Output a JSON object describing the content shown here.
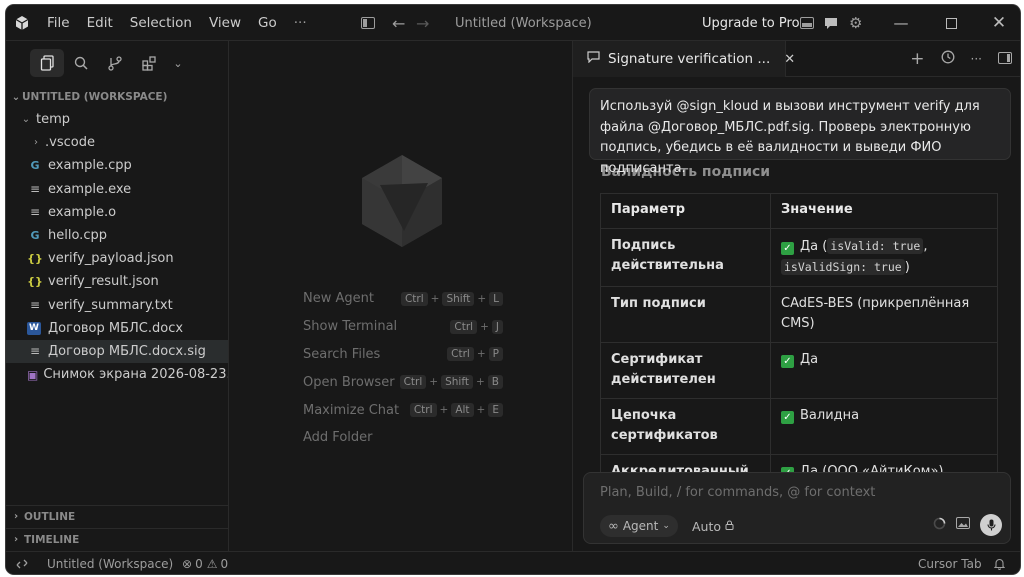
{
  "titlebar": {
    "menu": [
      "File",
      "Edit",
      "Selection",
      "View",
      "Go"
    ],
    "more": "···",
    "title": "Untitled (Workspace)",
    "upgrade": "Upgrade to Pro"
  },
  "sidebar": {
    "workspace_header": "UNTITLED (WORKSPACE)",
    "tree": [
      {
        "label": "temp",
        "kind": "folder-open",
        "indent": 1
      },
      {
        "label": ".vscode",
        "kind": "folder-closed",
        "indent": 2
      },
      {
        "label": "example.cpp",
        "kind": "cpp",
        "indent": 2
      },
      {
        "label": "example.exe",
        "kind": "lines",
        "indent": 2
      },
      {
        "label": "example.o",
        "kind": "lines",
        "indent": 2
      },
      {
        "label": "hello.cpp",
        "kind": "cpp",
        "indent": 2
      },
      {
        "label": "verify_payload.json",
        "kind": "json",
        "indent": 2
      },
      {
        "label": "verify_result.json",
        "kind": "json",
        "indent": 2
      },
      {
        "label": "verify_summary.txt",
        "kind": "lines",
        "indent": 2
      },
      {
        "label": "Договор МБЛС.docx",
        "kind": "word",
        "indent": 2
      },
      {
        "label": "Договор МБЛС.docx.sig",
        "kind": "lines",
        "indent": 2,
        "selected": true
      },
      {
        "label": "Снимок экрана 2026-08-23...",
        "kind": "image",
        "indent": 2
      }
    ],
    "outline": "OUTLINE",
    "timeline": "TIMELINE"
  },
  "center": {
    "shortcuts": [
      {
        "label": "New Agent",
        "keys": [
          "Ctrl",
          "Shift",
          "L"
        ]
      },
      {
        "label": "Show Terminal",
        "keys": [
          "Ctrl",
          "J"
        ]
      },
      {
        "label": "Search Files",
        "keys": [
          "Ctrl",
          "P"
        ]
      },
      {
        "label": "Open Browser",
        "keys": [
          "Ctrl",
          "Shift",
          "B"
        ]
      },
      {
        "label": "Maximize Chat",
        "keys": [
          "Ctrl",
          "Alt",
          "E"
        ]
      },
      {
        "label": "Add Folder",
        "keys": []
      }
    ]
  },
  "chat": {
    "tab_title": "Signature verification ...",
    "user_message": "Используй @sign_kloud и вызови инструмент verify для файла @Договор_МБЛС.pdf.sig. Проверь электронную подпись, убедись в её валидности и выведи ФИО подписанта.",
    "section_title": "Валидность подписи",
    "table": {
      "headers": [
        "Параметр",
        "Значение"
      ],
      "rows": [
        {
          "param": "Подпись действительна",
          "check": true,
          "value": "Да",
          "code1": "isValid: true",
          "code2": "isValidSign: true"
        },
        {
          "param": "Тип подписи",
          "check": false,
          "value": "CAdES-BES (прикреплённая CMS)"
        },
        {
          "param": "Сертификат действителен",
          "check": true,
          "value": "Да"
        },
        {
          "param": "Цепочка сертификатов",
          "check": true,
          "value": "Валидна"
        },
        {
          "param": "Аккредитованный УЦ",
          "check": true,
          "value": "Да (ООО «АйтиКом»)"
        }
      ]
    },
    "input_placeholder": "Plan, Build, / for commands, @ for context",
    "agent_label": "Agent",
    "auto_label": "Auto"
  },
  "statusbar": {
    "workspace": "Untitled (Workspace)",
    "errors": "0",
    "warnings": "0",
    "cursor_tab": "Cursor Tab"
  }
}
